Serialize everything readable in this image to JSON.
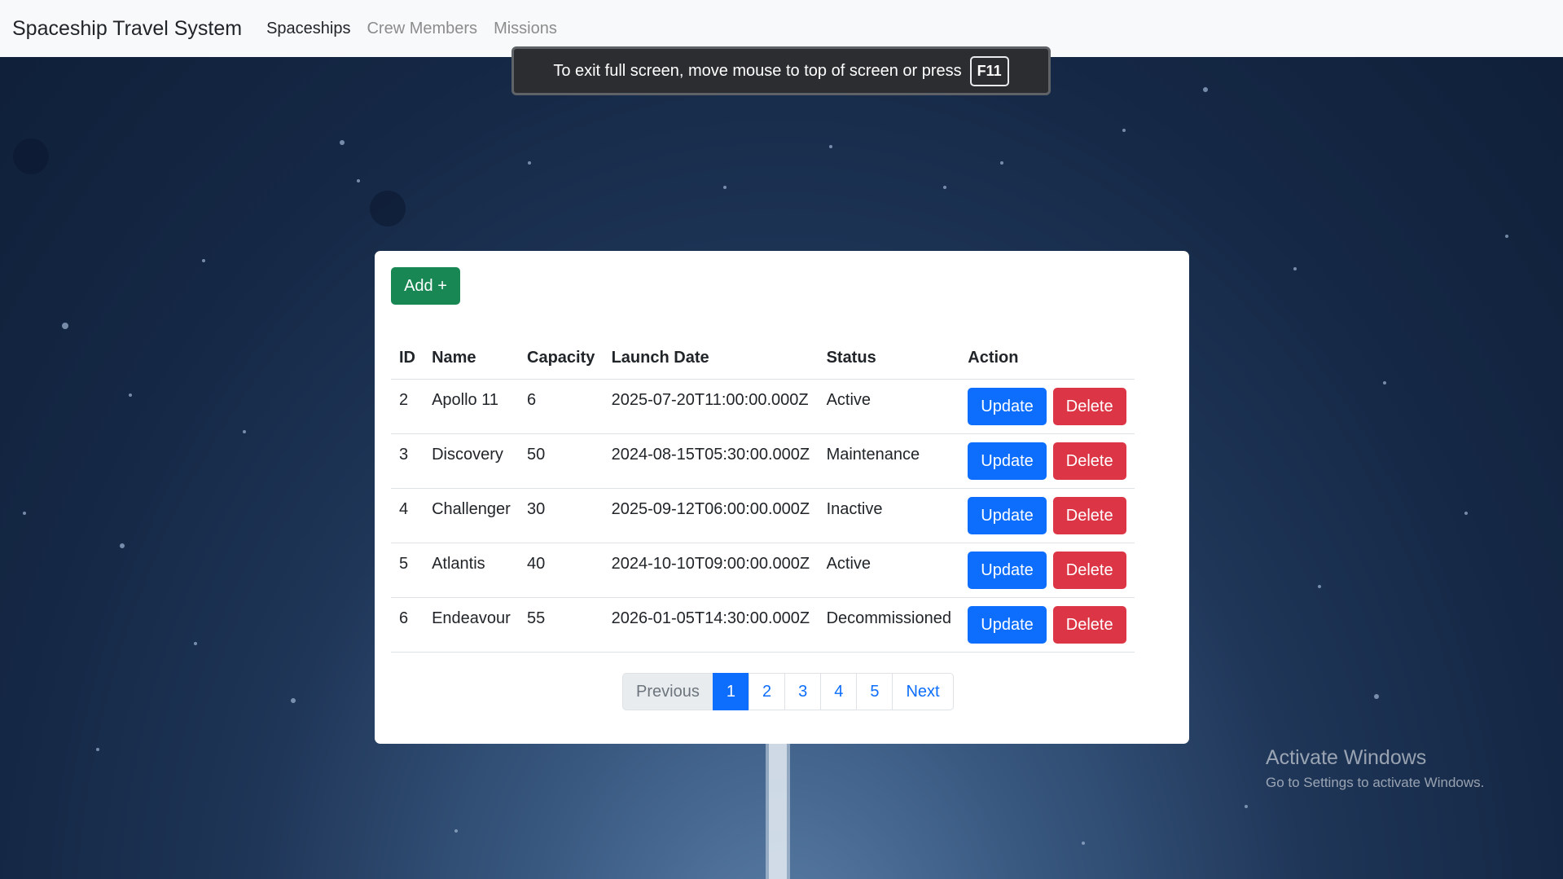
{
  "navbar": {
    "brand": "Spaceship Travel System",
    "links": [
      {
        "label": "Spaceships",
        "active": true
      },
      {
        "label": "Crew Members",
        "active": false
      },
      {
        "label": "Missions",
        "active": false
      }
    ]
  },
  "fullscreen_toast": {
    "message": "To exit full screen, move mouse to top of screen or press",
    "key": "F11"
  },
  "toolbar": {
    "add_label": "Add +"
  },
  "table": {
    "headers": [
      "ID",
      "Name",
      "Capacity",
      "Launch Date",
      "Status",
      "Action"
    ],
    "rows": [
      {
        "id": "2",
        "name": "Apollo 11",
        "capacity": "6",
        "launch_date": "2025-07-20T11:00:00.000Z",
        "status": "Active",
        "update_label": "Update",
        "delete_label": "Delete"
      },
      {
        "id": "3",
        "name": "Discovery",
        "capacity": "50",
        "launch_date": "2024-08-15T05:30:00.000Z",
        "status": "Maintenance",
        "update_label": "Update",
        "delete_label": "Delete"
      },
      {
        "id": "4",
        "name": "Challenger",
        "capacity": "30",
        "launch_date": "2025-09-12T06:00:00.000Z",
        "status": "Inactive",
        "update_label": "Update",
        "delete_label": "Delete"
      },
      {
        "id": "5",
        "name": "Atlantis",
        "capacity": "40",
        "launch_date": "2024-10-10T09:00:00.000Z",
        "status": "Active",
        "update_label": "Update",
        "delete_label": "Delete"
      },
      {
        "id": "6",
        "name": "Endeavour",
        "capacity": "55",
        "launch_date": "2026-01-05T14:30:00.000Z",
        "status": "Decommissioned",
        "update_label": "Update",
        "delete_label": "Delete"
      }
    ]
  },
  "pagination": {
    "previous_label": "Previous",
    "pages": [
      "1",
      "2",
      "3",
      "4",
      "5"
    ],
    "current_page": "1",
    "next_label": "Next"
  },
  "watermark": {
    "title": "Activate Windows",
    "subtitle": "Go to Settings to activate Windows."
  },
  "colors": {
    "primary": "#0d6efd",
    "success": "#198754",
    "danger": "#dc3545",
    "navbar_bg": "#f8f9fa"
  }
}
